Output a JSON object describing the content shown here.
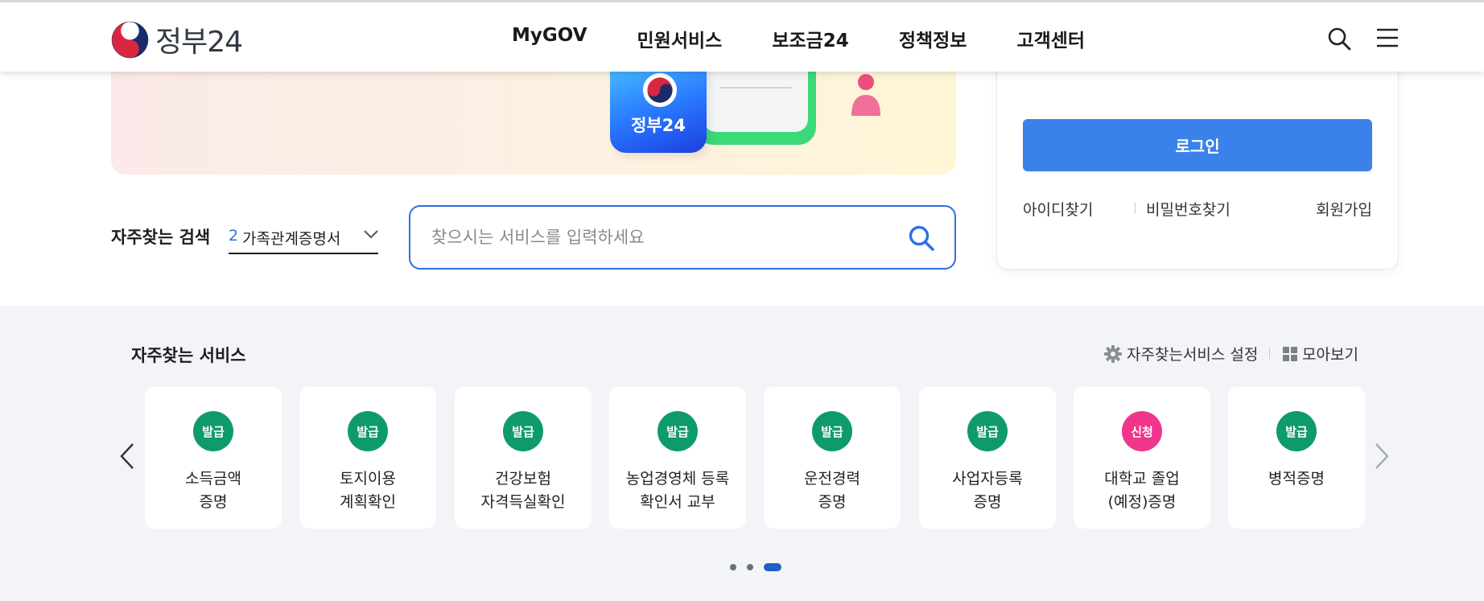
{
  "header": {
    "logo_text": "정부24",
    "nav": [
      "MyGOV",
      "민원서비스",
      "보조금24",
      "정책정보",
      "고객센터"
    ]
  },
  "banner": {
    "card_text": "정부24"
  },
  "search": {
    "frequent_label": "자주찾는 검색",
    "frequent_rank": "2",
    "frequent_keyword": "가족관계증명서",
    "placeholder": "찾으시는 서비스를 입력하세요",
    "value": ""
  },
  "login": {
    "button_label": "로그인",
    "find_id": "아이디찾기",
    "find_password": "비밀번호찾기",
    "signup": "회원가입"
  },
  "services": {
    "title": "자주찾는 서비스",
    "setting_label": "자주찾는서비스 설정",
    "view_all_label": "모아보기",
    "items": [
      {
        "badge": "발급",
        "label": "소득금액\n증명",
        "badge_color": "#0f9a6e"
      },
      {
        "badge": "발급",
        "label": "토지이용\n계획확인",
        "badge_color": "#0f9a6e"
      },
      {
        "badge": "발급",
        "label": "건강보험\n자격득실확인",
        "badge_color": "#0f9a6e"
      },
      {
        "badge": "발급",
        "label": "농업경영체 등록\n확인서 교부",
        "badge_color": "#0f9a6e"
      },
      {
        "badge": "발급",
        "label": "운전경력\n증명",
        "badge_color": "#0f9a6e"
      },
      {
        "badge": "발급",
        "label": "사업자등록\n증명",
        "badge_color": "#0f9a6e"
      },
      {
        "badge": "신청",
        "label": "대학교 졸업\n(예정)증명",
        "badge_color": "#f0358c"
      },
      {
        "badge": "발급",
        "label": "병적증명",
        "badge_color": "#0f9a6e"
      }
    ],
    "pagination": {
      "total": 3,
      "current": 3
    }
  },
  "colors": {
    "primary_blue": "#3a82ea",
    "issue_green": "#0f9a6e",
    "apply_pink": "#f0358c"
  }
}
